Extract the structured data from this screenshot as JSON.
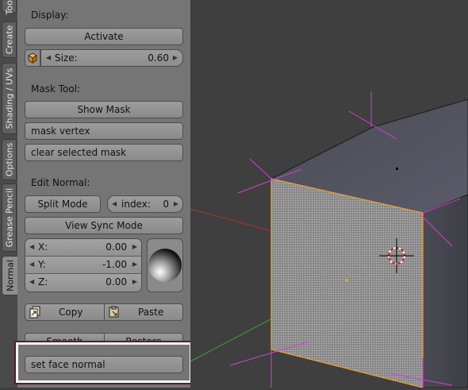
{
  "sidebar_tabs": [
    {
      "label": "Tools",
      "active": false
    },
    {
      "label": "Create",
      "active": false
    },
    {
      "label": "Shading / UVs",
      "active": false
    },
    {
      "label": "Options",
      "active": false
    },
    {
      "label": "Grease Pencil",
      "active": false
    },
    {
      "label": "Normal",
      "active": true
    }
  ],
  "display": {
    "heading": "Display:",
    "activate_label": "Activate",
    "size_label": "Size:",
    "size_value": "0.60"
  },
  "mask_tool": {
    "heading": "Mask Tool:",
    "show_mask_label": "Show Mask",
    "mask_vertex_label": "mask vertex",
    "clear_selected_mask_label": "clear selected mask"
  },
  "edit_normal": {
    "heading": "Edit Normal:",
    "split_mode_label": "Split Mode",
    "index_label": "index:",
    "index_value": "0",
    "view_sync_mode_label": "View Sync Mode",
    "x_label": "X:",
    "x_value": "0.00",
    "y_label": "Y:",
    "y_value": "-1.00",
    "z_label": "Z:",
    "z_value": "0.00",
    "copy_label": "Copy",
    "paste_label": "Paste",
    "hidden_left_label": "Smooth",
    "hidden_right_label": "Restore",
    "set_face_normal_label": "set face normal"
  },
  "colors": {
    "selected_face_outline": "#f0a030",
    "normals": "#d040d0",
    "x_axis": "#b03030",
    "y_axis": "#40a040"
  }
}
